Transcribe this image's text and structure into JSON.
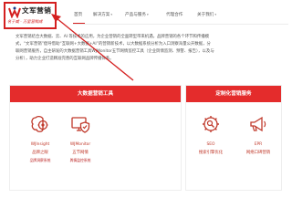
{
  "logo": {
    "title": "文军营销",
    "slogan": "名于威 · 万里营销成",
    "icon": "wj-brand-mark"
  },
  "nav": {
    "items": [
      {
        "label": "首页"
      },
      {
        "label": "解决方案",
        "has_dropdown": true
      },
      {
        "label": "产品与服务",
        "has_dropdown": true
      },
      {
        "label": "代理合作"
      },
      {
        "label": "关于我们",
        "has_dropdown": true
      }
    ],
    "active_index": 0
  },
  "intro": {
    "lines": [
      "文军营销结合大数据、云、AI 等技术的应用，为企业营销的全面转型带来机遇。品牌营销的各个环节和传播模",
      "式，“文军营销”倡导借助“互联网+大数据+AI”的营销新技术，以大数据系统分析为入口洞察海量公开数据，分",
      "联网营销服务，自主研发的大数据营销工具WJMonitor五节网情监控工具（企业舆情监测、预警、报告），以及与",
      "分析），助力企业打造精准完善的互联网品牌传播体系。"
    ]
  },
  "sections": {
    "tools": {
      "title": "大数据营销工具",
      "items": [
        {
          "name": "WJInsight",
          "sub": "品牌之眼",
          "desc": "品牌洞察系统",
          "icon": "brain-gear-icon"
        },
        {
          "name": "WJMonitor",
          "sub": "五节网情",
          "desc": "舆情监控系统",
          "icon": "computer-shield-icon"
        }
      ]
    },
    "services": {
      "title": "定制化营销服务",
      "items": [
        {
          "name": "SEO",
          "sub": "搜索引擎优化",
          "desc": "",
          "icon": "seo-gear-icon"
        },
        {
          "name": "EPR",
          "sub": "网络口碑营销",
          "desc": "",
          "icon": "megaphone-icon"
        }
      ]
    }
  },
  "colors": {
    "brand_red": "#e42c2c",
    "annotation_red": "#d41f1f"
  }
}
